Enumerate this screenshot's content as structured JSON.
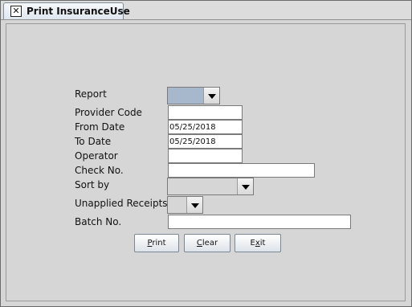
{
  "tab": {
    "close_glyph": "✕",
    "title": "Print InsuranceUse"
  },
  "form": {
    "report_label": "Report",
    "provider_code_label": "Provider Code",
    "provider_code_value": "",
    "from_date_label": "From Date",
    "from_date_value": "05/25/2018",
    "to_date_label": "To Date",
    "to_date_value": "05/25/2018",
    "operator_label": "Operator",
    "operator_value": "",
    "check_no_label": "Check No.",
    "check_no_value": "",
    "sort_by_label": "Sort by",
    "unapplied_receipts_label": "Unapplied Receipts",
    "batch_no_label": "Batch No.",
    "batch_no_value": ""
  },
  "buttons": {
    "print": {
      "mnemonic": "P",
      "rest": "rint"
    },
    "clear": {
      "mnemonic": "C",
      "rest": "lear"
    },
    "exit": {
      "prefix": "E",
      "mnemonic": "x",
      "rest": "it"
    }
  },
  "colors": {
    "report_combo_selection": "#a8b8cc",
    "background": "#d6d6d6"
  }
}
